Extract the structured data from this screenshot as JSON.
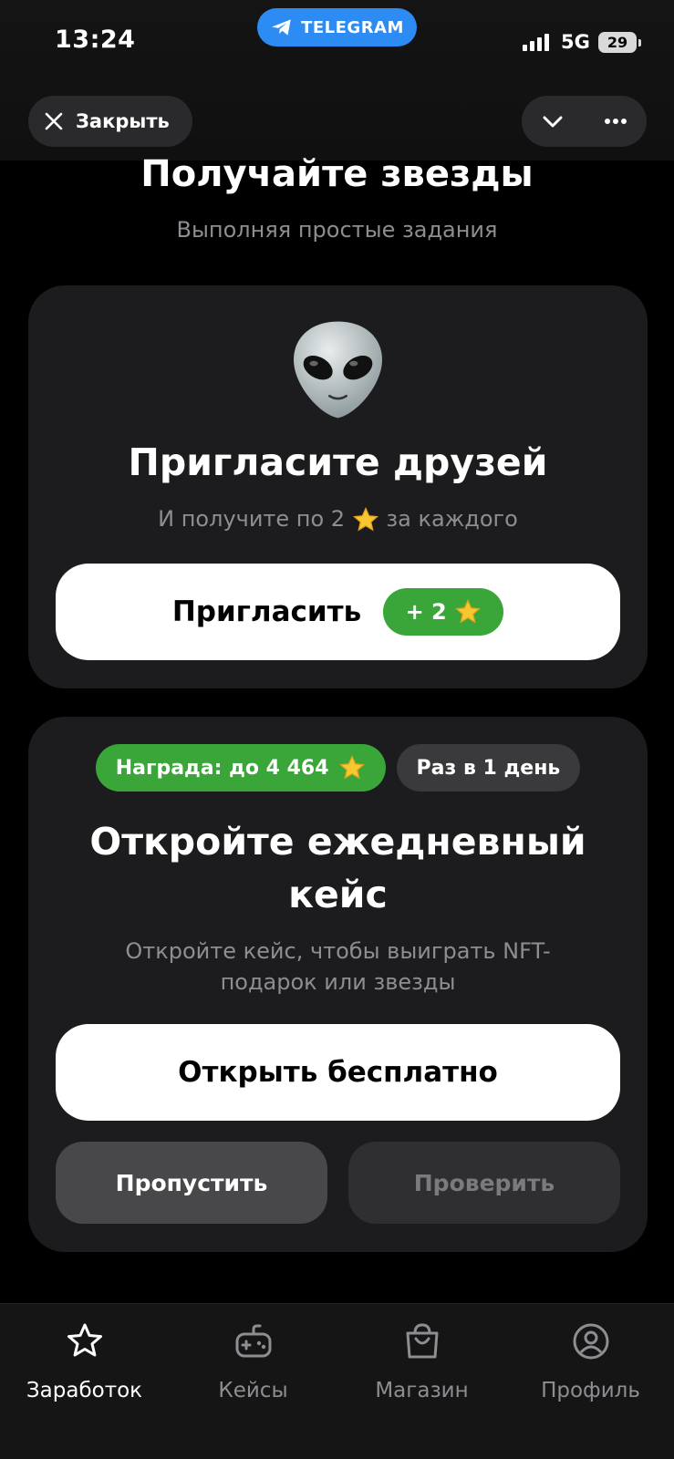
{
  "status_bar": {
    "time": "13:24",
    "telegram_label": "TELEGRAM",
    "network": "5G",
    "battery": "29"
  },
  "header": {
    "close_label": "Закрыть"
  },
  "page": {
    "title": "Получайте звезды",
    "subtitle": "Выполняя простые задания"
  },
  "invite_card": {
    "title": "Пригласите друзей",
    "description_before": "И получите по 2",
    "description_after": "за каждого",
    "button_label": "Пригласить",
    "bonus_label": "+ 2"
  },
  "case_card": {
    "reward_badge": "Награда: до 4 464",
    "frequency_badge": "Раз в 1 день",
    "title_line1": "Откройте ежедневный",
    "title_line2": "кейс",
    "description_line1": "Откройте кейс, чтобы выиграть NFT-",
    "description_line2": "подарок или звезды",
    "open_button": "Открыть бесплатно",
    "skip_button": "Пропустить",
    "check_button": "Проверить"
  },
  "tabs": [
    {
      "label": "Заработок",
      "icon": "star-icon",
      "active": true
    },
    {
      "label": "Кейсы",
      "icon": "gamepad-icon",
      "active": false
    },
    {
      "label": "Магазин",
      "icon": "shopping-bag-icon",
      "active": false
    },
    {
      "label": "Профиль",
      "icon": "profile-icon",
      "active": false
    }
  ],
  "colors": {
    "accent_green": "#3aa63a",
    "telegram_blue": "#2c8cf4",
    "card_bg": "#1c1c1e"
  }
}
